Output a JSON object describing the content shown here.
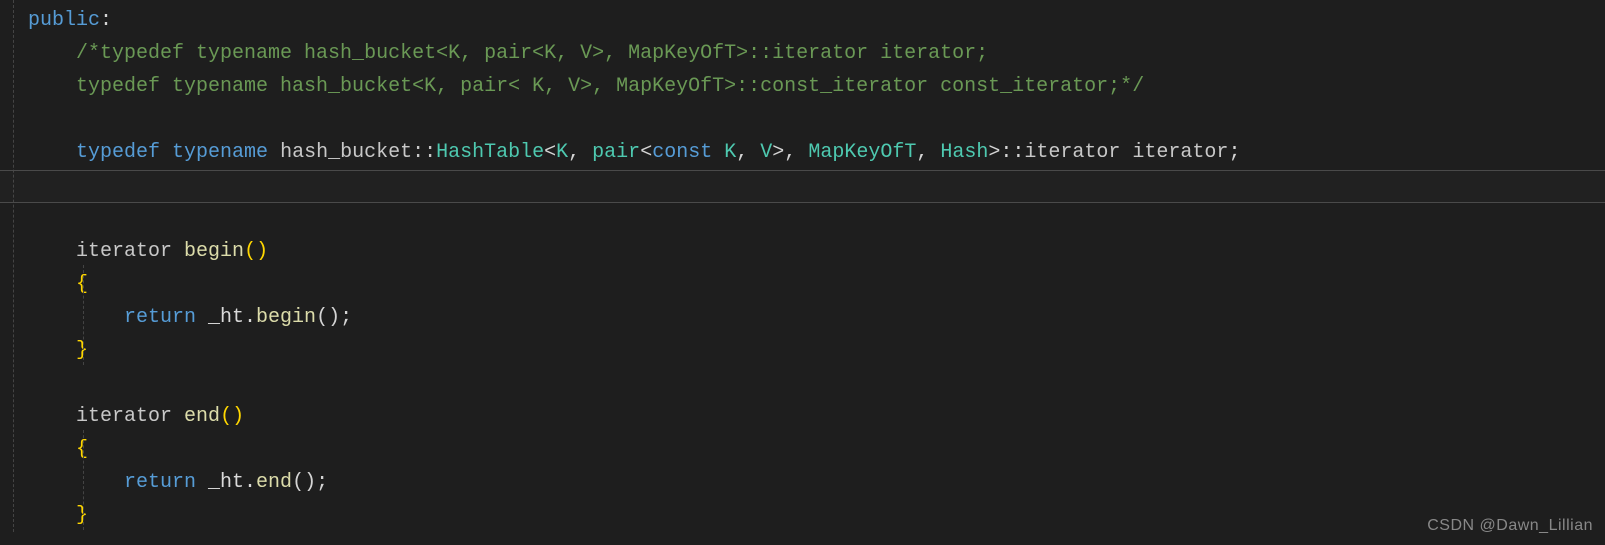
{
  "code": {
    "line1_public": "public",
    "line1_colon": ":",
    "line2_comment": "/*typedef typename hash_bucket<K, pair<K, V>, MapKeyOfT>::iterator iterator;",
    "line3_comment": "typedef typename hash_bucket<K, pair< K, V>, MapKeyOfT>::const_iterator const_iterator;*/",
    "line5_typedef": "typedef",
    "line5_typename": "typename",
    "line5_ns": " hash_bucket::",
    "line5_hashtable": "HashTable",
    "line5_lt": "<",
    "line5_K1": "K",
    "line5_comma1": ", ",
    "line5_pair": "pair",
    "line5_lt2": "<",
    "line5_const": "const",
    "line5_space": " ",
    "line5_K2": "K",
    "line5_comma2": ", ",
    "line5_V": "V",
    "line5_gt2": ">",
    "line5_comma3": ", ",
    "line5_mapkey": "MapKeyOfT",
    "line5_comma4": ", ",
    "line5_hash": "Hash",
    "line5_gt": ">::",
    "line5_iter1": "iterator",
    "line5_space2": " ",
    "line5_iter2": "iterator",
    "line5_semi": ";",
    "line8_iterator": "iterator ",
    "line8_begin": "begin",
    "line8_parens": "()",
    "line9_brace": "{",
    "line10_return": "return",
    "line10_ht": " _ht.",
    "line10_begin": "begin",
    "line10_end": "();",
    "line11_brace": "}",
    "line13_iterator": "iterator ",
    "line13_end": "end",
    "line13_parens": "()",
    "line14_brace": "{",
    "line15_return": "return",
    "line15_ht": " _ht.",
    "line15_end": "end",
    "line15_call": "();",
    "line16_brace": "}"
  },
  "watermark": "CSDN @Dawn_Lillian"
}
